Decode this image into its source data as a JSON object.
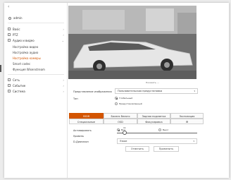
{
  "sidebar": {
    "back_icon": "chevron-left-icon",
    "user": "admin",
    "items": [
      {
        "label": "Basic",
        "icon": "info-icon"
      },
      {
        "label": "PTZ",
        "icon": "ptz-icon"
      },
      {
        "label": "Аудио и видео",
        "icon": "camera-icon"
      }
    ],
    "subitems": [
      {
        "label": "Настройка видео"
      },
      {
        "label": "Настройка аудио"
      },
      {
        "label": "Настройка камеры"
      },
      {
        "label": "Smart codec"
      },
      {
        "label": "Функция Wisenstream"
      }
    ],
    "items2": [
      {
        "label": "Сеть",
        "icon": "network-icon"
      },
      {
        "label": "Событие",
        "icon": "event-icon"
      },
      {
        "label": "Система",
        "icon": "system-icon"
      }
    ]
  },
  "preview": {
    "label": "Показать ---"
  },
  "form": {
    "profile_label": "Представление изображения",
    "profile_value": "Пользовательская предустановка",
    "type_label": "Тип",
    "type_opt1": "Глобальный",
    "type_opt2": "Предустановленный"
  },
  "tabs": {
    "row1": [
      "SSDR",
      "Баланс белого",
      "Задняя подсветка",
      "Экспозиция"
    ],
    "row2": [
      "Специальные",
      "OSD",
      "Фокусировка",
      "IR"
    ],
    "active": "SSDR"
  },
  "ssdr": {
    "enable_label": "Активировать",
    "on_label": "Вкл",
    "off_label": "Выкл",
    "level_label": "Уровень",
    "level_value": "11",
    "level_fraction": 0.07,
    "drange_label": "D-Диапазон",
    "drange_value": "Узкое"
  },
  "buttons": {
    "cancel": "Отменить",
    "apply": "Применить"
  }
}
